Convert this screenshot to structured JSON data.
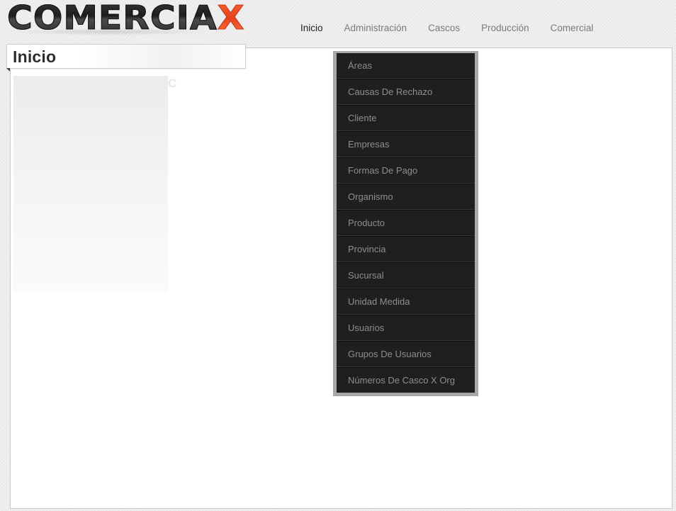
{
  "brand": {
    "logo_main": "COMERCIA",
    "logo_accent": "X"
  },
  "nav": {
    "items": [
      {
        "label": "Inicio",
        "active": true
      },
      {
        "label": "Administración",
        "active": false
      },
      {
        "label": "Cascos",
        "active": false
      },
      {
        "label": "Producción",
        "active": false
      },
      {
        "label": "Comercial",
        "active": false
      }
    ]
  },
  "page": {
    "title": "Inicio",
    "partial_glyph": "C"
  },
  "admin_menu": {
    "items": [
      "Áreas",
      "Causas De Rechazo",
      "Cliente",
      "Empresas",
      "Formas De Pago",
      "Organismo",
      "Producto",
      "Provincia",
      "Sucursal",
      "Unidad Medida",
      "Usuarios",
      "Grupos De Usuarios",
      "Números De Casco X Org"
    ]
  },
  "colors": {
    "accent": "#e4421a",
    "menu_background": "#1f1f1f",
    "menu_text": "#8e8e8e",
    "nav_active": "#222222",
    "nav_inactive": "#7a7a7a"
  }
}
